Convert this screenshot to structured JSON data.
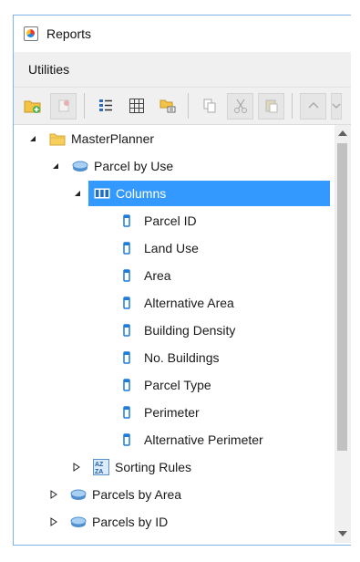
{
  "window": {
    "title": "Reports"
  },
  "menu": {
    "items": [
      "Utilities"
    ]
  },
  "toolbar": {
    "buttons": [
      "add-folder-icon",
      "add-report-icon",
      "list-view-icon",
      "grid-icon",
      "properties-icon",
      "copy-icon",
      "cut-icon",
      "paste-icon",
      "move-up-icon",
      "move-down-icon"
    ]
  },
  "tree": {
    "root": "MasterPlanner",
    "report1": "Parcel by Use",
    "columns": "Columns",
    "column_items": [
      "Parcel ID",
      "Land Use",
      "Area",
      "Alternative Area",
      "Building Density",
      "No. Buildings",
      "Parcel Type",
      "Perimeter",
      "Alternative Perimeter"
    ],
    "sorting_rules": "Sorting Rules",
    "report2": "Parcels by Area",
    "report3": "Parcels by ID"
  },
  "colors": {
    "selection": "#3399ff",
    "folder": "#f5c242",
    "report": "#5b9bd5",
    "column": "#1e7bd8",
    "border": "#7eb4ea"
  }
}
